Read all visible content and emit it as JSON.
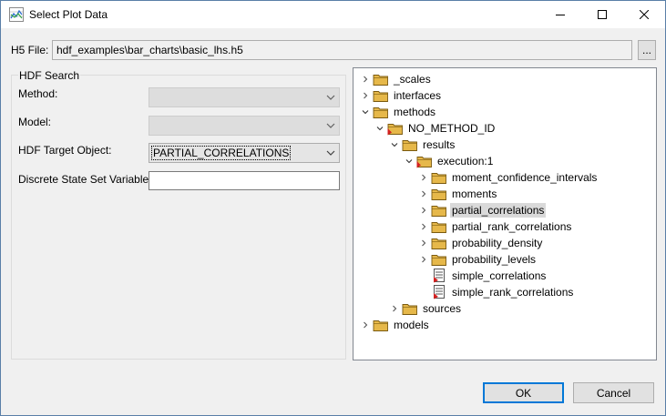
{
  "window": {
    "title": "Select Plot Data"
  },
  "h5": {
    "label": "H5 File:",
    "path": "hdf_examples\\bar_charts\\basic_lhs.h5",
    "browse_label": "..."
  },
  "search": {
    "title": "HDF Search",
    "method_label": "Method:",
    "method_value": "",
    "model_label": "Model:",
    "model_value": "",
    "target_label": "HDF Target Object:",
    "target_value": "PARTIAL_CORRELATIONS",
    "discrete_label": "Discrete State Set Variable:",
    "discrete_value": ""
  },
  "tree": {
    "nodes": [
      {
        "label": "_scales",
        "icon": "folder-icon",
        "expander": "collapsed"
      },
      {
        "label": "interfaces",
        "icon": "folder-icon",
        "expander": "collapsed"
      },
      {
        "label": "methods",
        "icon": "folder-icon",
        "expander": "expanded"
      },
      {
        "label": "NO_METHOD_ID",
        "icon": "folder-tagged-icon",
        "expander": "expanded"
      },
      {
        "label": "results",
        "icon": "folder-icon",
        "expander": "expanded"
      },
      {
        "label": "execution:1",
        "icon": "folder-tagged-icon",
        "expander": "expanded"
      },
      {
        "label": "moment_confidence_intervals",
        "icon": "folder-icon",
        "expander": "collapsed"
      },
      {
        "label": "moments",
        "icon": "folder-icon",
        "expander": "collapsed"
      },
      {
        "label": "partial_correlations",
        "icon": "folder-icon",
        "expander": "collapsed",
        "selected": true
      },
      {
        "label": "partial_rank_correlations",
        "icon": "folder-icon",
        "expander": "collapsed"
      },
      {
        "label": "probability_density",
        "icon": "folder-icon",
        "expander": "collapsed"
      },
      {
        "label": "probability_levels",
        "icon": "folder-icon",
        "expander": "collapsed"
      },
      {
        "label": "simple_correlations",
        "icon": "dataset-icon",
        "expander": "none"
      },
      {
        "label": "simple_rank_correlations",
        "icon": "dataset-icon",
        "expander": "none"
      },
      {
        "label": "sources",
        "icon": "folder-icon",
        "expander": "collapsed"
      },
      {
        "label": "models",
        "icon": "folder-icon",
        "expander": "collapsed"
      }
    ]
  },
  "buttons": {
    "ok": "OK",
    "cancel": "Cancel"
  },
  "colors": {
    "accent": "#0078d7",
    "folder": "#e6b84a",
    "tag": "#d42020"
  }
}
